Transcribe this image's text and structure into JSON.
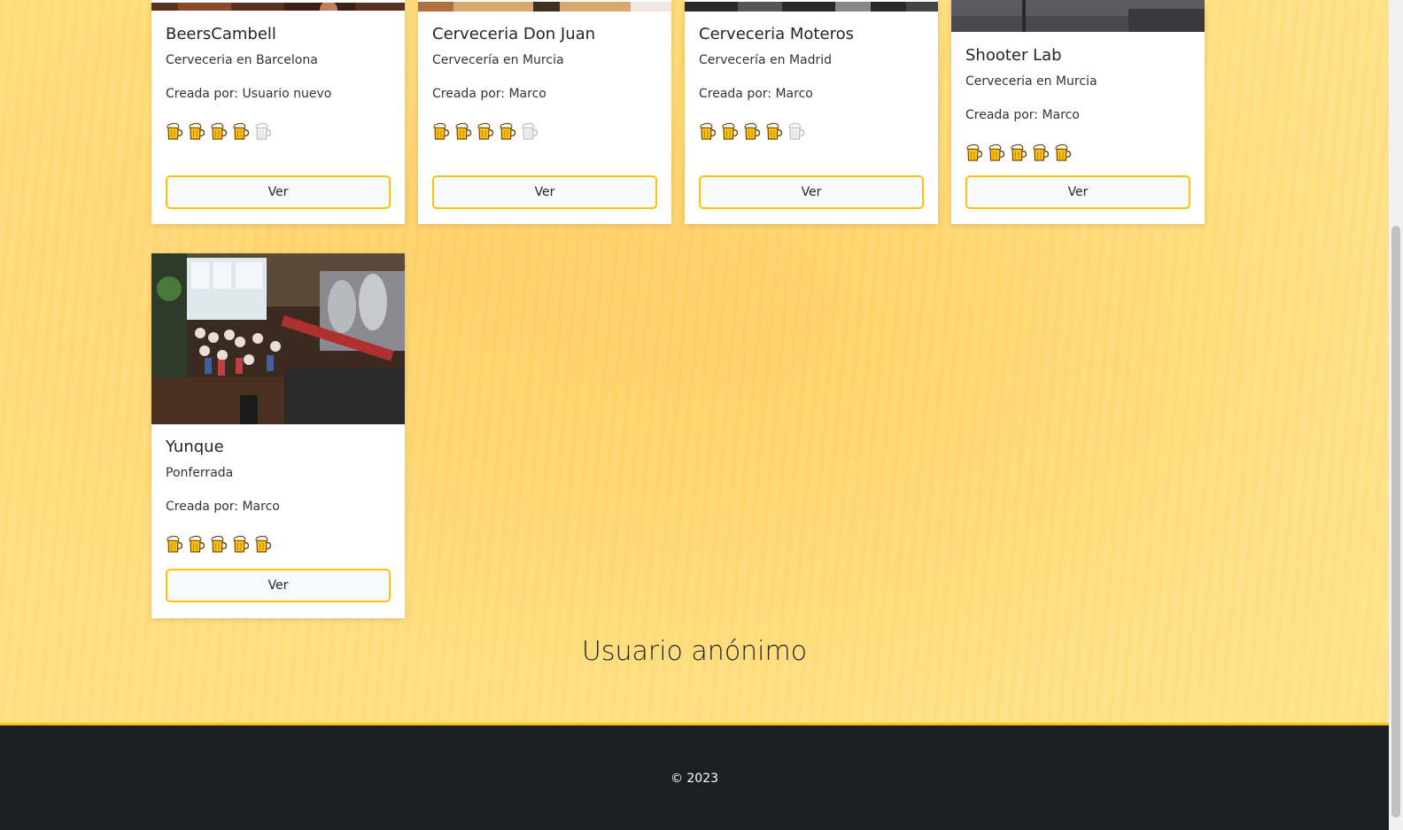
{
  "cards": [
    {
      "title": "BeersCambell",
      "subtitle": "Cerveceria en Barcelona",
      "creator": "Creada por: Usuario nuevo",
      "rating": 4,
      "button": "Ver"
    },
    {
      "title": "Cerveceria Don Juan",
      "subtitle": "Cervecería en Murcia",
      "creator": "Creada por: Marco",
      "rating": 4,
      "button": "Ver"
    },
    {
      "title": "Cerveceria Moteros",
      "subtitle": "Cervecería en Madrid",
      "creator": "Creada por: Marco",
      "rating": 4,
      "button": "Ver"
    },
    {
      "title": "Shooter Lab",
      "subtitle": "Cerveceria en Murcia",
      "creator": "Creada por: Marco",
      "rating": 5,
      "button": "Ver"
    },
    {
      "title": "Yunque",
      "subtitle": "Ponferrada",
      "creator": "Creada por: Marco",
      "rating": 5,
      "button": "Ver"
    }
  ],
  "rating_max": 5,
  "section": {
    "title": "Usuario anónimo"
  },
  "footer": {
    "copyright": "© 2023"
  },
  "colors": {
    "accent": "#ffc107",
    "footer_bg": "#1b2026",
    "page_bg": "#ffdf82"
  },
  "icons": {
    "rating": "beer-mug-icon"
  }
}
